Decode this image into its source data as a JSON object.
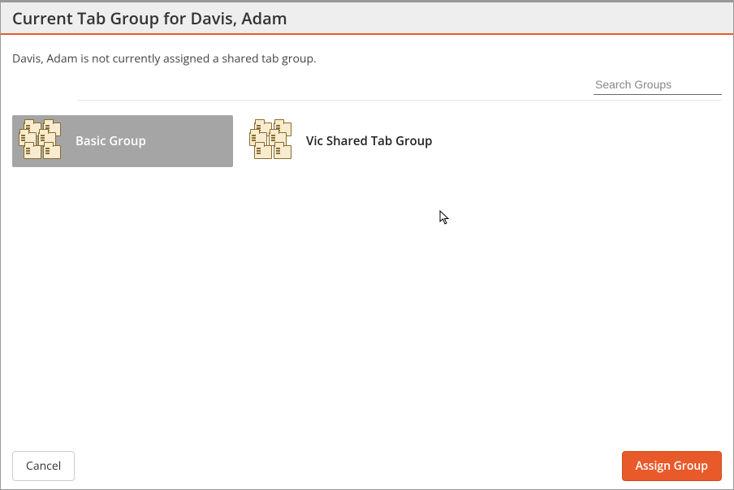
{
  "header": {
    "title": "Current Tab Group for Davis, Adam"
  },
  "status": {
    "text": "Davis, Adam is not currently assigned a shared tab group."
  },
  "search": {
    "placeholder": "Search Groups",
    "value": ""
  },
  "groups": [
    {
      "label": "Basic Group",
      "selected": true
    },
    {
      "label": "Vic Shared Tab Group",
      "selected": false
    }
  ],
  "footer": {
    "cancel_label": "Cancel",
    "assign_label": "Assign Group"
  }
}
